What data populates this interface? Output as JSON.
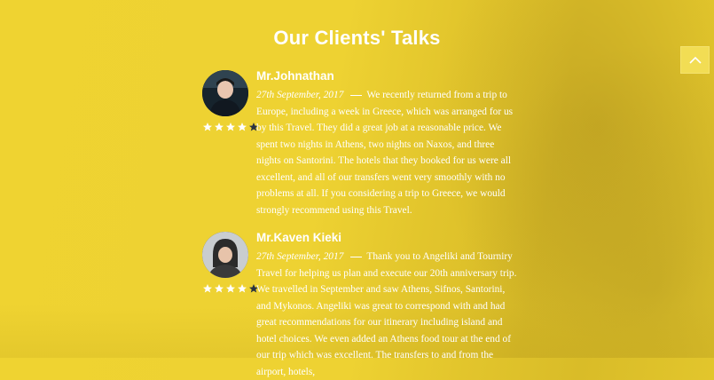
{
  "section": {
    "title": "Our Clients' Talks"
  },
  "reviews": [
    {
      "name": "Mr.Johnathan",
      "date": "27th September, 2017",
      "text": "We recently returned from a trip to Europe, including a week in Greece, which was arranged for us by this Travel. They did a great job at a reasonable price. We spent two nights in Athens, two nights on Naxos, and three nights on Santorini. The hotels that they booked for us were all excellent, and all of our transfers went very smoothly with no problems at all. If you considering a trip to Greece, we would strongly recommend using this Travel.",
      "rating": 4,
      "rating_max": 5
    },
    {
      "name": "Mr.Kaven Kieki",
      "date": "27th September, 2017",
      "text": "Thank you to Angeliki and Tourniry Travel for helping us plan and execute our 20th anniversary trip. We travelled in September and saw Athens, Sifnos, Santorini, and Mykonos. Angeliki was great to correspond with and had great recommendations for our itinerary including island and hotel choices. We even added an Athens food tour at the end of our trip which was excellent. The transfers to and from the airport, hotels,",
      "rating": 4,
      "rating_max": 5
    }
  ],
  "colors": {
    "background": "#efd331",
    "text": "#ffffff",
    "star_filled": "#ffffff",
    "star_empty": "#2a3340"
  },
  "icons": {
    "scroll_top": "chevron-up-icon",
    "star": "star-icon"
  }
}
